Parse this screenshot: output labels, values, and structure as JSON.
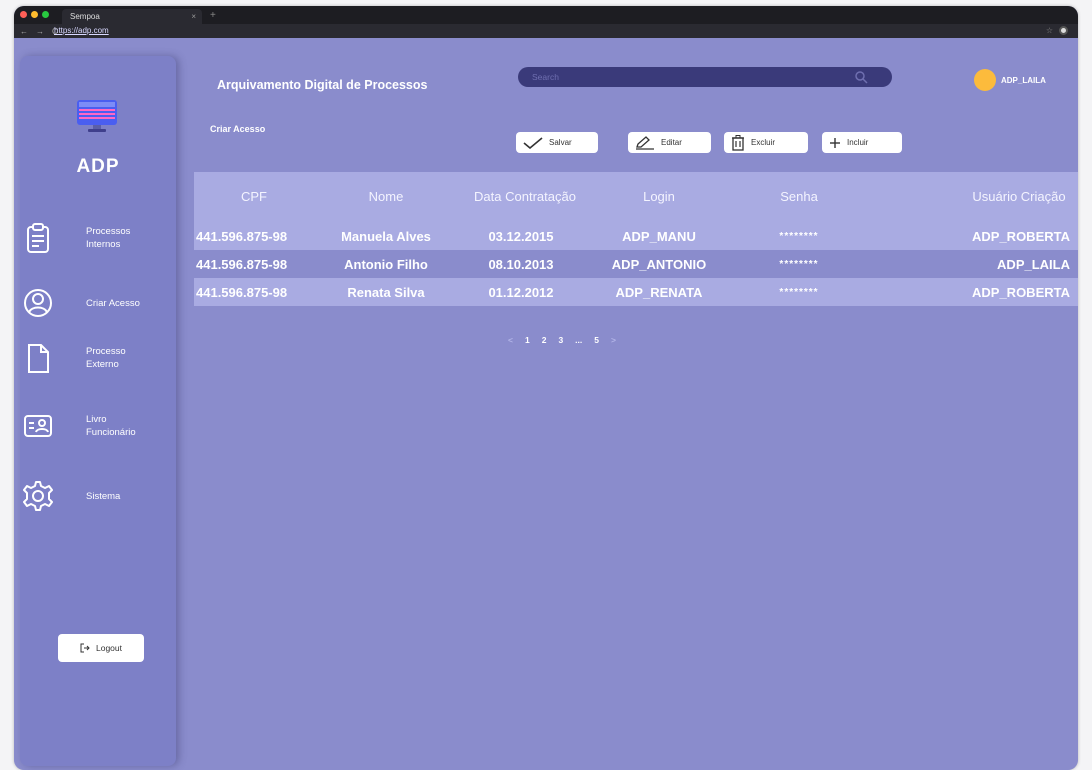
{
  "browser": {
    "tab_title": "Sempoa",
    "url": "https://adp.com"
  },
  "app": {
    "logo_text": "ADP",
    "title": "Arquivamento Digital de Processos",
    "section_title": "Criar Acesso"
  },
  "search": {
    "placeholder": "Search"
  },
  "user": {
    "name": "ADP_LAILA"
  },
  "sidebar": {
    "items": [
      {
        "label": "Processos Internos",
        "icon": "clipboard-icon"
      },
      {
        "label": "Criar Acesso",
        "icon": "user-circle-icon"
      },
      {
        "label": "Processo Externo",
        "icon": "document-icon"
      },
      {
        "label": "Livro Funcionário",
        "icon": "id-card-icon"
      },
      {
        "label": "Sistema",
        "icon": "gear-icon"
      }
    ],
    "logout_label": "Logout"
  },
  "toolbar": {
    "save_label": "Salvar",
    "edit_label": "Editar",
    "delete_label": "Excluir",
    "add_label": "Incluir"
  },
  "table": {
    "headers": [
      "CPF",
      "Nome",
      "Data Contratação",
      "Login",
      "Senha",
      "Usuário Criação"
    ],
    "rows": [
      {
        "cpf": "441.596.875-98",
        "nome": "Manuela Alves",
        "data": "03.12.2015",
        "login": "ADP_MANU",
        "senha": "********",
        "usuario": "ADP_ROBERTA"
      },
      {
        "cpf": "441.596.875-98",
        "nome": "Antonio Filho",
        "data": "08.10.2013",
        "login": "ADP_ANTONIO",
        "senha": "********",
        "usuario": "ADP_LAILA"
      },
      {
        "cpf": "441.596.875-98",
        "nome": "Renata Silva",
        "data": "01.12.2012",
        "login": "ADP_RENATA",
        "senha": "********",
        "usuario": "ADP_ROBERTA"
      }
    ]
  },
  "pagination": {
    "prev": "<",
    "pages": [
      "1",
      "2",
      "3",
      "...",
      "5"
    ],
    "next": ">"
  },
  "colors": {
    "background": "#8a8ccc",
    "sidebar": "#7d80c7",
    "table_stripe": "#a9abe2",
    "search_bg": "#3a3a7a",
    "avatar": "#fcbb3c"
  }
}
